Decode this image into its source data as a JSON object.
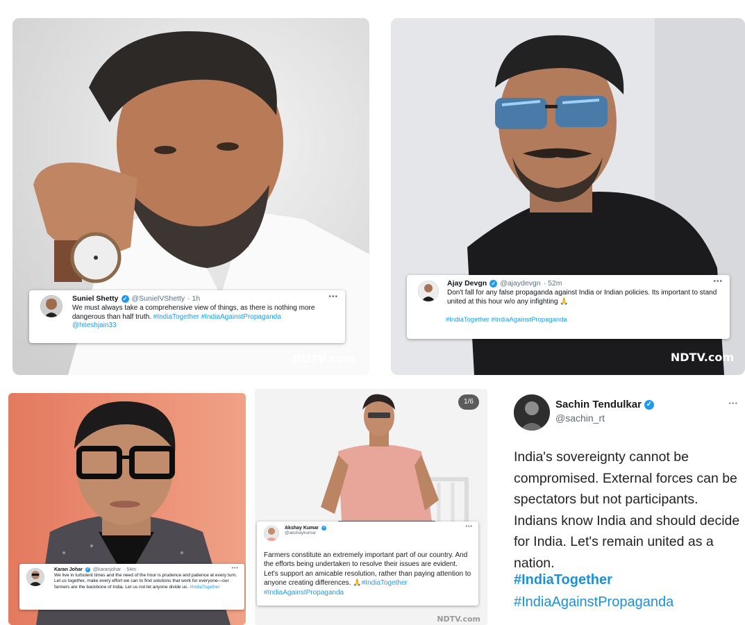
{
  "panels": {
    "shetty": {
      "name": "Suniel Shetty",
      "handle": "@SunielVShetty",
      "time": "· 1h",
      "text": "We must always take a comprehensive view of things, as there is nothing more dangerous than half truth.",
      "tags": "#IndiaTogether #IndiaAgainstPropaganda",
      "mention": "@hiteshjain33",
      "watermark": "NDTV.com"
    },
    "devgn": {
      "name": "Ajay Devgn",
      "handle": "@ajaydevgn",
      "time": "· 52m",
      "text": "Don't fall for any false propaganda against India or Indian policies. Its important to stand united at this hour w/o any infighting 🙏",
      "tags": "#IndiaTogether #IndiaAgainstPropaganda",
      "watermark": "NDTV.com"
    },
    "johar": {
      "name": "Karan Johar",
      "handle": "@karanjohar",
      "time": "· 54m",
      "text": "We live in turbulent times and the need of the hour is prudence and patience at every turn. Let us together, make every effort we can to find solutions that work for everyone—our farmers are the backbone of India. Let us not let anyone divide us.",
      "tags": "#IndiaTogether"
    },
    "kumar": {
      "pager": "1/6",
      "name": "Akshay Kumar",
      "handle": "@akshaykumar",
      "text": "Farmers constitute an extremely important part of our country. And the efforts being undertaken to resolve their issues are evident. Let's support an amicable resolution, rather than paying attention to anyone creating differences. 🙏",
      "tags": "#IndiaTogether #IndiaAgainstPropaganda",
      "watermark": "NDTV.com"
    },
    "tendulkar": {
      "name": "Sachin Tendulkar",
      "handle": "@sachin_rt",
      "text": "India's sovereignty cannot be compromised. External forces can be spectators but not participants. Indians know India and should decide for India. Let's remain united as a nation.",
      "tag1": "#IndiaTogether",
      "tag2": "#IndiaAgainstPropaganda"
    }
  },
  "icons": {
    "verified": "verified-badge-icon",
    "more": "more-options-icon"
  },
  "colors": {
    "hashtag": "#1d9bf0",
    "verified": "#1d9bf0"
  }
}
